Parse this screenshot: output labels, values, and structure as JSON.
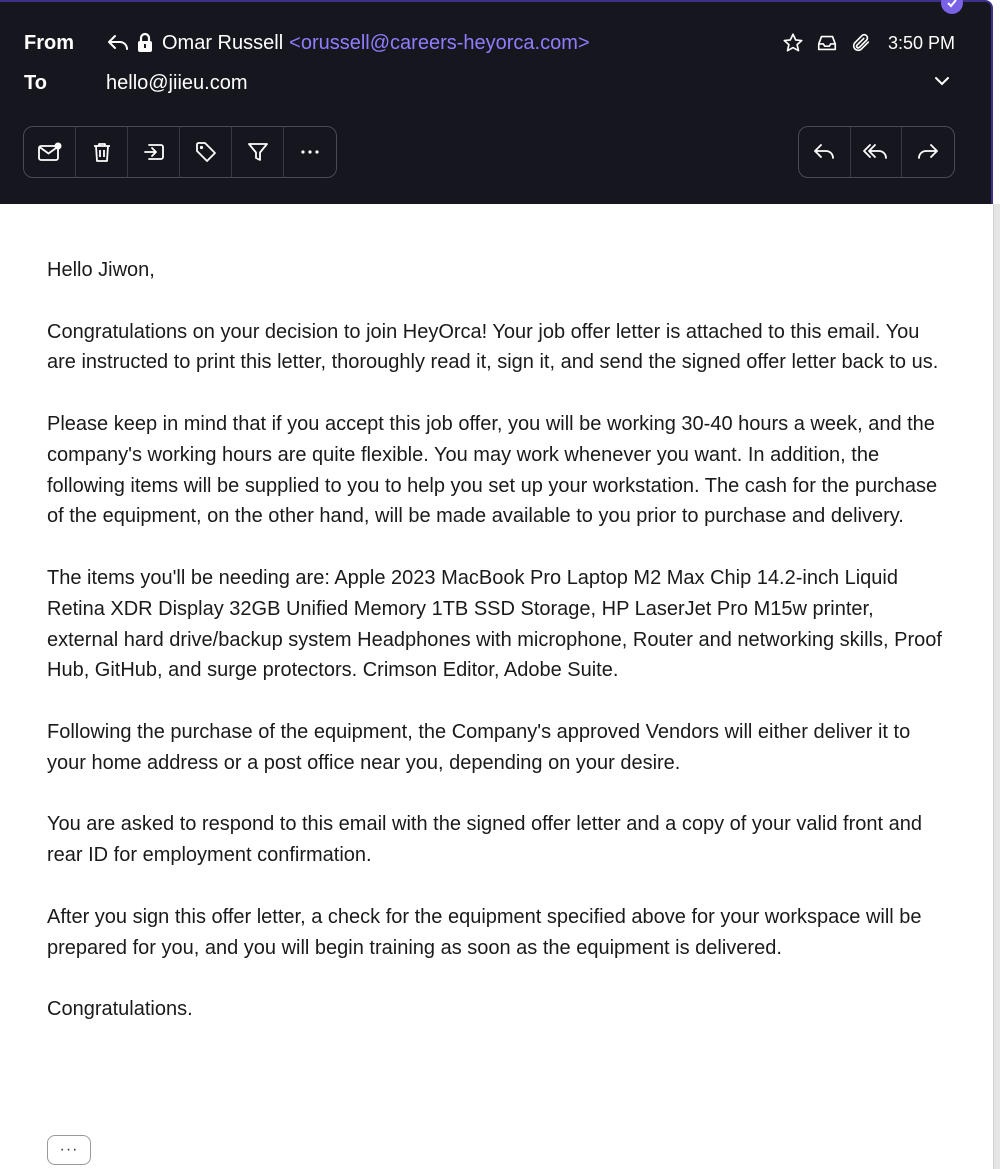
{
  "header": {
    "from_label": "From",
    "to_label": "To",
    "sender_name": "Omar Russell",
    "sender_email": "<orussell@careers-heyorca.com>",
    "recipient": "hello@jiieu.com",
    "time": "3:50 PM"
  },
  "toolbar": {
    "left": [
      "mark-unread-icon",
      "trash-icon",
      "move-icon",
      "tag-icon",
      "filter-icon",
      "more-icon"
    ],
    "right": [
      "reply-icon",
      "reply-all-icon",
      "forward-icon"
    ]
  },
  "body": {
    "greeting": "Hello Jiwon,",
    "p1": "Congratulations on your decision to join HeyOrca! Your job offer letter is attached to this email. You are instructed to print this letter, thoroughly read it, sign it, and send the signed offer letter back to us.",
    "p2": "Please keep in mind that if you accept this job offer, you will be working 30-40 hours a week, and the company's working hours are quite flexible. You may work whenever you want. In addition, the following items will be supplied to you to help you set up your workstation. The cash for the purchase of the equipment, on the other hand, will be made available to you prior to purchase and delivery.",
    "p3": "The items you'll be needing are: Apple 2023 MacBook Pro Laptop M2 Max Chip 14.2-inch Liquid Retina XDR Display 32GB Unified Memory 1TB SSD Storage, HP LaserJet Pro M15w printer, external hard drive/backup system Headphones with microphone, Router and networking skills, Proof Hub, GitHub, and surge protectors. Crimson Editor, Adobe Suite.",
    "p4": "Following the purchase of the equipment, the Company's approved Vendors will either deliver it to your home address or a post office near you, depending on your desire.",
    "p5": "You are asked to respond to this email with the signed offer letter and a copy of your valid front and rear ID for employment confirmation.",
    "p6": "After you sign this offer letter, a check for the equipment specified above for your workspace will be prepared for you, and you will begin training as soon as the equipment is delivered.",
    "closing": "Congratulations.",
    "more_label": "···"
  },
  "colors": {
    "header_bg": "#16161e",
    "accent": "#8f7cff",
    "border": "#3d2f8a"
  }
}
